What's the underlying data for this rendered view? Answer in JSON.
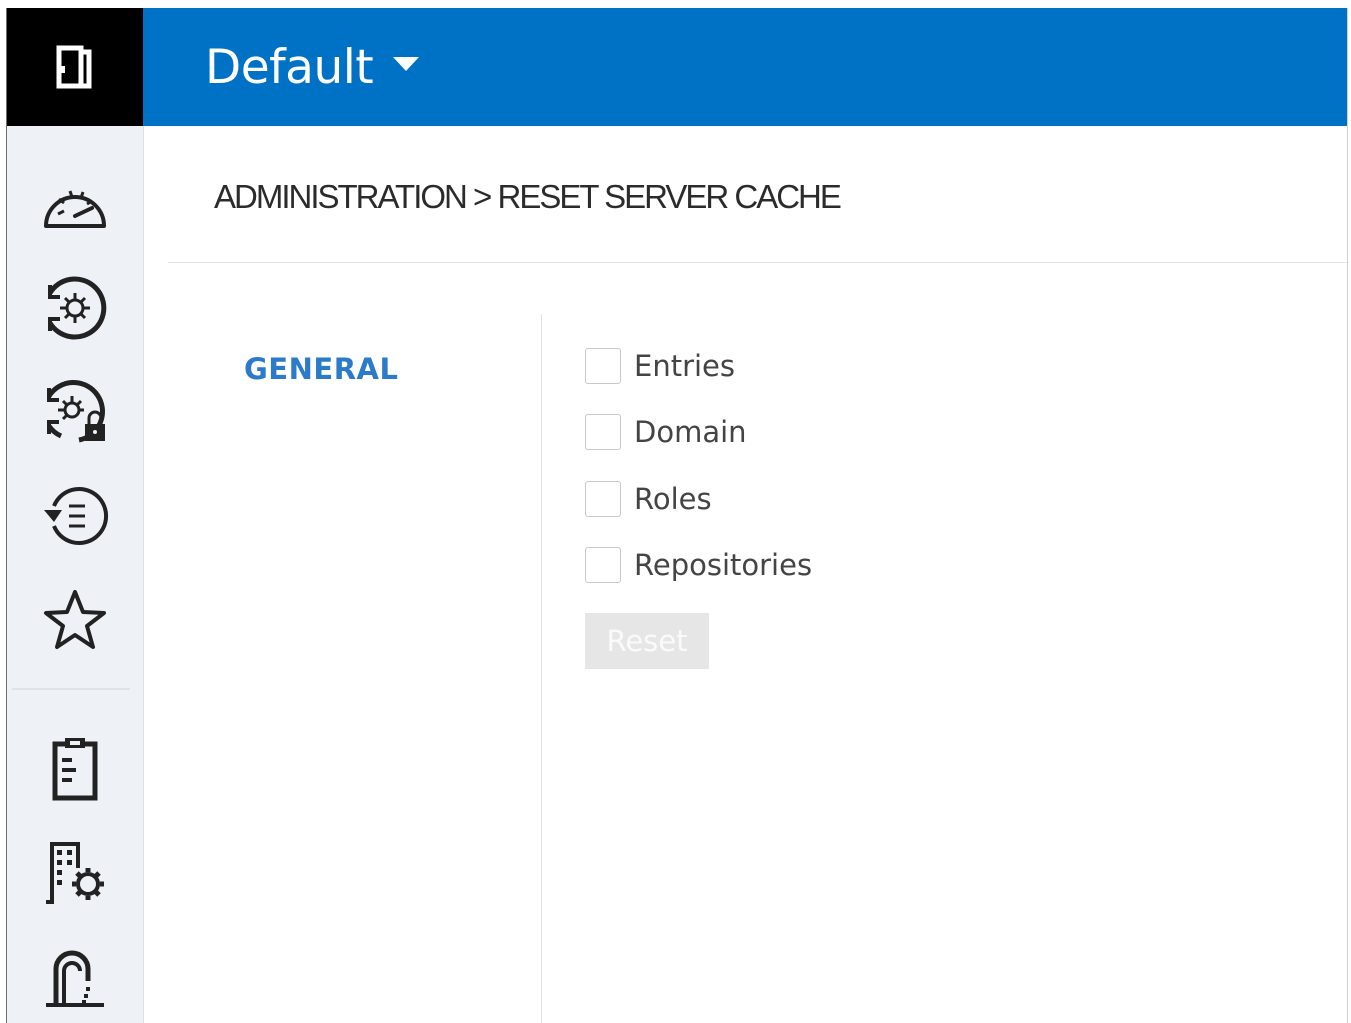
{
  "header": {
    "app_title": "Default",
    "logo_icon": "logo-book-icon",
    "dropdown_icon": "caret-down-icon",
    "bar_color": "#0072c6"
  },
  "sidebar": {
    "items": [
      {
        "name": "dashboard",
        "icon": "speedometer-icon"
      },
      {
        "name": "system-sync",
        "icon": "sync-settings-icon"
      },
      {
        "name": "system-sync-locked",
        "icon": "sync-settings-lock-icon"
      },
      {
        "name": "history",
        "icon": "history-list-icon"
      },
      {
        "name": "favorites",
        "icon": "star-icon"
      },
      {
        "name": "tasks",
        "icon": "clipboard-icon"
      },
      {
        "name": "org-settings",
        "icon": "building-gear-icon"
      },
      {
        "name": "access",
        "icon": "archway-icon"
      }
    ]
  },
  "page": {
    "breadcrumb": "ADMINISTRATION > RESET SERVER CACHE",
    "section": "GENERAL",
    "options": [
      {
        "label": "Entries",
        "checked": false
      },
      {
        "label": "Domain",
        "checked": false
      },
      {
        "label": "Roles",
        "checked": false
      },
      {
        "label": "Repositories",
        "checked": false
      }
    ],
    "reset_label": "Reset"
  }
}
